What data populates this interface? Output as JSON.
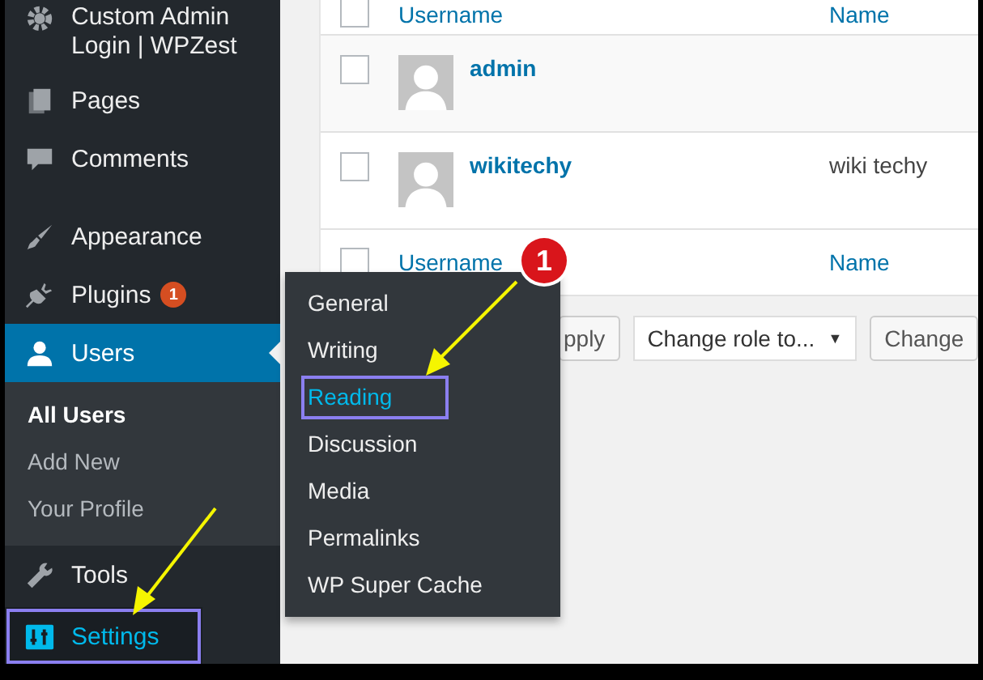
{
  "sidebar": {
    "items": [
      {
        "label": "Custom Admin Login | WPZest",
        "kind": "gear",
        "selected": false,
        "highlighted": false
      },
      {
        "label": "Pages",
        "kind": "pages",
        "selected": false,
        "highlighted": false
      },
      {
        "label": "Comments",
        "kind": "comment",
        "selected": false,
        "highlighted": false
      },
      {
        "kind": "separator"
      },
      {
        "label": "Appearance",
        "kind": "brush",
        "selected": false,
        "highlighted": false
      },
      {
        "label": "Plugins",
        "kind": "plug",
        "selected": false,
        "highlighted": false,
        "badge": "1"
      },
      {
        "label": "Users",
        "kind": "user",
        "selected": true,
        "highlighted": false,
        "children": [
          {
            "label": "All Users",
            "selected": true
          },
          {
            "label": "Add New",
            "selected": false
          },
          {
            "label": "Your Profile",
            "selected": false
          }
        ]
      },
      {
        "label": "Tools",
        "kind": "wrench",
        "selected": false,
        "highlighted": false
      },
      {
        "label": "Settings",
        "kind": "sliders",
        "selected": false,
        "highlighted": true
      }
    ]
  },
  "flyout": {
    "items": [
      {
        "label": "General",
        "selected": false,
        "highlighted": false
      },
      {
        "label": "Writing",
        "selected": false,
        "highlighted": false
      },
      {
        "label": "Reading",
        "selected": true,
        "highlighted": true
      },
      {
        "label": "Discussion",
        "selected": false,
        "highlighted": false
      },
      {
        "label": "Media",
        "selected": false,
        "highlighted": false
      },
      {
        "label": "Permalinks",
        "selected": false,
        "highlighted": false
      },
      {
        "label": "WP Super Cache",
        "selected": false,
        "highlighted": false
      }
    ]
  },
  "table": {
    "columns": [
      "Username",
      "Name"
    ],
    "header_checked": false,
    "rows": [
      {
        "username": "admin",
        "checked": false
      },
      {
        "username": "wikitechy",
        "name": "wiki techy",
        "checked": false
      }
    ],
    "footer_columns": [
      "Username",
      "Name"
    ],
    "footer_checked": false
  },
  "tablenav": {
    "apply_button": "pply",
    "role_select": "Change role to...",
    "role_caret": "▼",
    "change_button": "Change"
  },
  "callout": "1"
}
